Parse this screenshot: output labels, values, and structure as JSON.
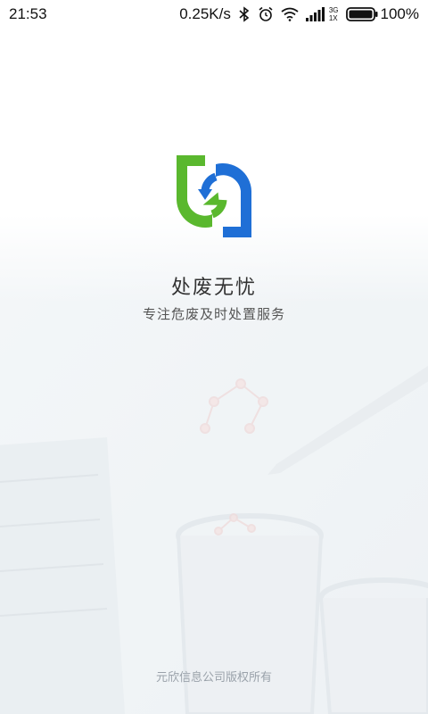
{
  "status_bar": {
    "time": "21:53",
    "net_speed": "0.25K/s",
    "network_type": "3G",
    "sim_slot": "1X",
    "battery": "100%",
    "icons": [
      "bluetooth-icon",
      "alarm-icon",
      "wifi-icon",
      "signal-icon",
      "battery-icon"
    ]
  },
  "splash": {
    "title": "处废无忧",
    "slogan": "专注危废及时处置服务",
    "copyright": "元欣信息公司版权所有"
  },
  "colors": {
    "logo_green": "#5ab82e",
    "logo_blue": "#1f6fd6",
    "background": "#ffffff"
  }
}
